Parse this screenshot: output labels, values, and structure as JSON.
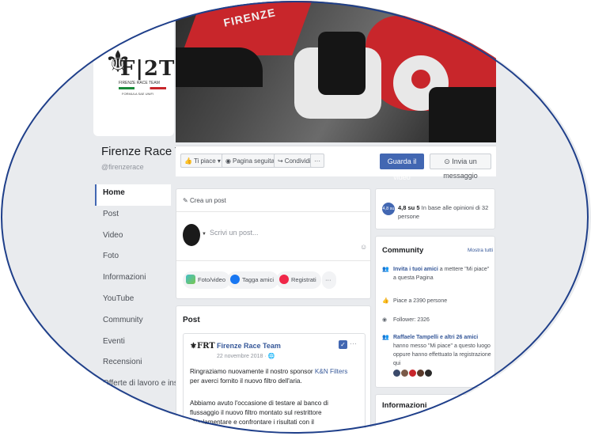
{
  "page": {
    "name": "Firenze Race Team",
    "handle": "@firenzerace"
  },
  "logo": {
    "mark": "F|2T",
    "tagline": "FIRENZE RACE TEAM",
    "sub": "FORMULA SAE UNIFI"
  },
  "cover": {
    "text": "FIRENZE"
  },
  "nav": {
    "items": [
      "Home",
      "Post",
      "Video",
      "Foto",
      "Informazioni",
      "YouTube",
      "Community",
      "Eventi",
      "Recensioni",
      "Offerte di lavoro e inserzioni"
    ]
  },
  "actions": {
    "like": "Ti piace",
    "follow": "Pagina seguita",
    "share": "Condividi",
    "more": "···",
    "watch_video": "Guarda il video",
    "send_message": "Invia un messaggio"
  },
  "composer": {
    "title": "Crea un post",
    "placeholder": "Scrivi un post...",
    "photo_video": "Foto/video",
    "tag_friends": "Tagga amici",
    "checkin": "Registrati",
    "more": "···"
  },
  "posts": {
    "title": "Post",
    "author": "Firenze Race Team",
    "date": "22 novembre 2018",
    "text1_a": "Ringraziamo nuovamente il nostro sponsor ",
    "text1_link": "K&N Filters",
    "text1_b": " per averci fornito il nuovo filtro dell'aria.",
    "text2": "Abbiamo avuto l'occasione di testare al banco di flussaggio il nuovo filtro montato sul restrittore regolamentare e confrontare i risultati con il"
  },
  "rating": {
    "score": "4,8 su 5",
    "detail": "In base alle opinioni di 32 persone"
  },
  "community": {
    "title": "Community",
    "see_all": "Mostra tutti",
    "invite_link": "Invita i tuoi amici",
    "invite_rest": "a mettere \"Mi piace\" a questa Pagina",
    "likes": "Piace a 2390 persone",
    "followers": "Follower: 2326",
    "friends_link": "Raffaele Tampelli e altri 26 amici",
    "friends_rest": "hanno messo \"Mi piace\" a questo luogo oppure hanno effettuato la registrazione qui"
  },
  "info": {
    "title": "Informazioni"
  },
  "colors": {
    "facebook_blue": "#4267b2",
    "link_blue": "#365899",
    "background": "#e9ebee",
    "ring": "#1f3f8a",
    "team_red": "#c8262b"
  }
}
